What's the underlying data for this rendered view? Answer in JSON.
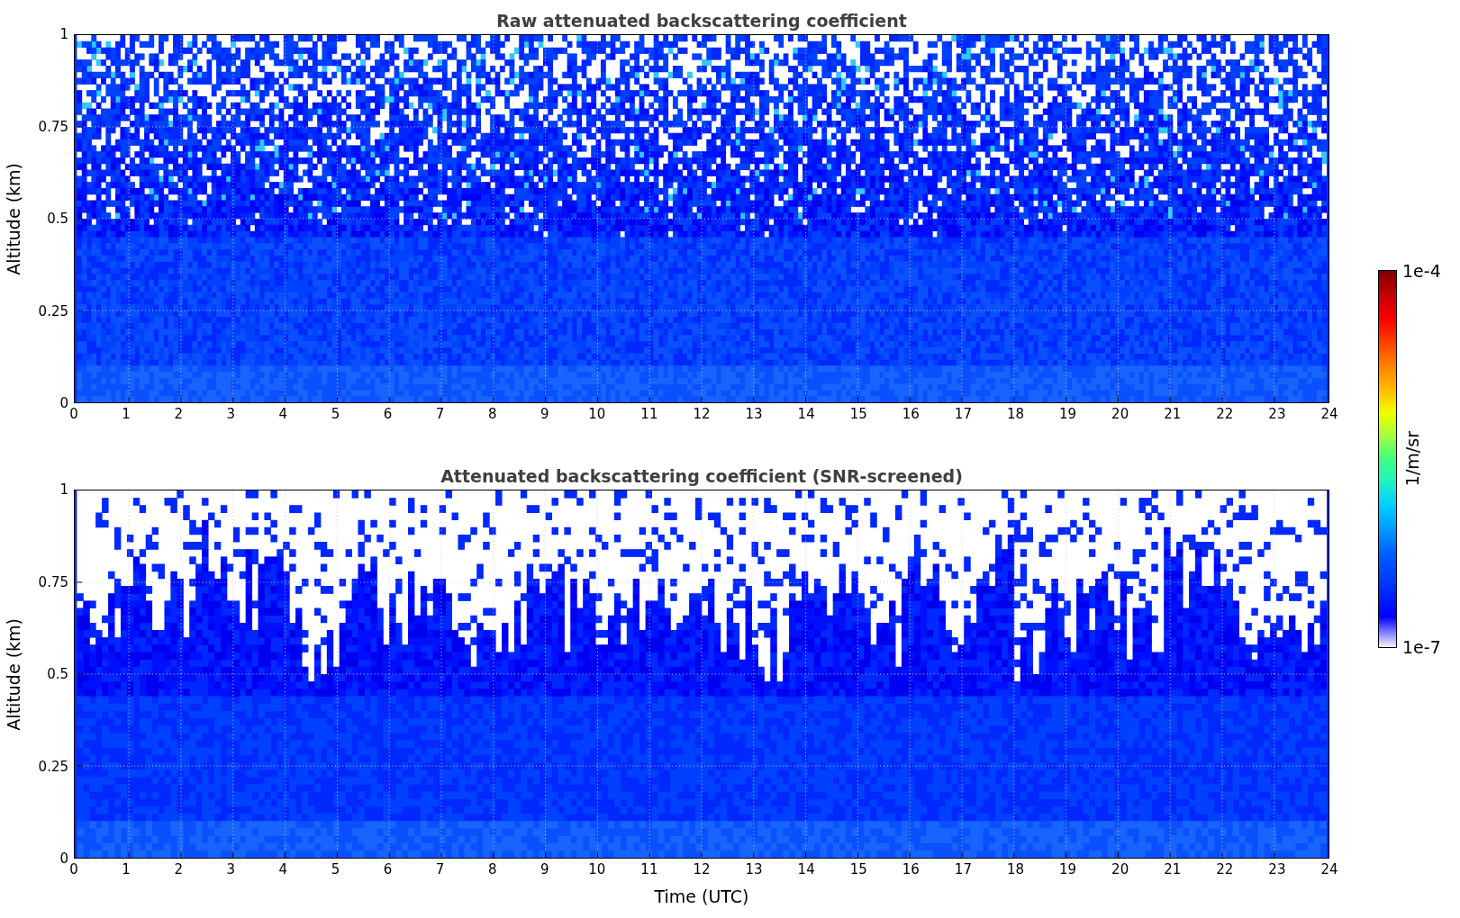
{
  "panels": [
    {
      "title": "Raw attenuated backscattering coefficient",
      "ylabel": "Altitude (km)",
      "yticks": [
        "1",
        "0.75",
        "0.5",
        "0.25",
        "0"
      ],
      "xticks": [
        "0",
        "1",
        "2",
        "3",
        "4",
        "5",
        "6",
        "7",
        "8",
        "9",
        "10",
        "11",
        "12",
        "13",
        "14",
        "15",
        "16",
        "17",
        "18",
        "19",
        "20",
        "21",
        "22",
        "23",
        "24"
      ],
      "screened": false
    },
    {
      "title": "Attenuated backscattering coefficient (SNR-screened)",
      "ylabel": "Altitude (km)",
      "yticks": [
        "1",
        "0.75",
        "0.5",
        "0.25",
        "0"
      ],
      "xticks": [
        "0",
        "1",
        "2",
        "3",
        "4",
        "5",
        "6",
        "7",
        "8",
        "9",
        "10",
        "11",
        "12",
        "13",
        "14",
        "15",
        "16",
        "17",
        "18",
        "19",
        "20",
        "21",
        "22",
        "23",
        "24"
      ],
      "screened": true
    }
  ],
  "xlabel": "Time (UTC)",
  "colorbar": {
    "max": "1e-4",
    "label": "1/m/sr",
    "min": "1e-7"
  }
}
